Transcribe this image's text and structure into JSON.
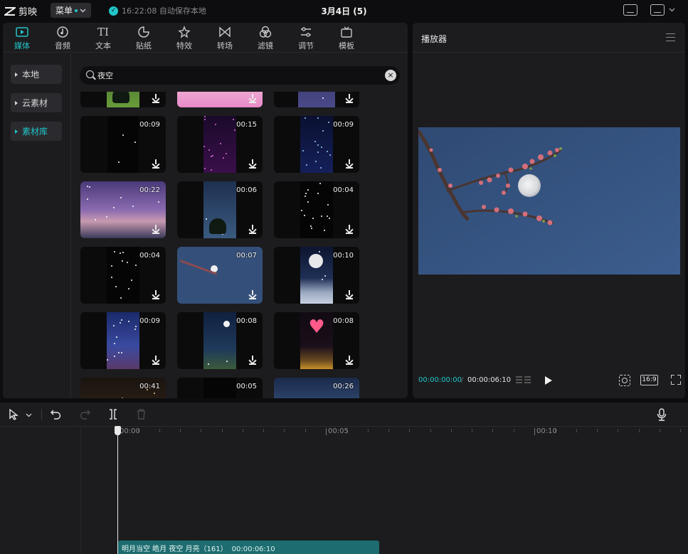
{
  "app": {
    "name": "剪映",
    "menu_label": "菜单",
    "save_status": "16:22:08 自动保存本地",
    "project_title": "3月4日 (5)"
  },
  "tabs": [
    {
      "label": "媒体",
      "icon": "media-icon",
      "active": true
    },
    {
      "label": "音频",
      "icon": "audio-icon"
    },
    {
      "label": "文本",
      "icon": "text-icon",
      "glyph": "TI"
    },
    {
      "label": "贴纸",
      "icon": "sticker-icon"
    },
    {
      "label": "特效",
      "icon": "effects-icon"
    },
    {
      "label": "转场",
      "icon": "transition-icon"
    },
    {
      "label": "滤镜",
      "icon": "filter-icon"
    },
    {
      "label": "调节",
      "icon": "adjust-icon"
    },
    {
      "label": "模板",
      "icon": "template-icon"
    }
  ],
  "side_nav": [
    {
      "label": "本地"
    },
    {
      "label": "云素材"
    },
    {
      "label": "素材库",
      "active": true
    }
  ],
  "search": {
    "value": "夜空"
  },
  "media_tiles": [
    {
      "duration": ""
    },
    {
      "duration": ""
    },
    {
      "duration": ""
    },
    {
      "duration": "00:09"
    },
    {
      "duration": "00:15"
    },
    {
      "duration": "00:09"
    },
    {
      "duration": "00:22"
    },
    {
      "duration": "00:06"
    },
    {
      "duration": "00:04"
    },
    {
      "duration": "00:04"
    },
    {
      "duration": "00:07"
    },
    {
      "duration": "00:10"
    },
    {
      "duration": "00:09"
    },
    {
      "duration": "00:08"
    },
    {
      "duration": "00:08"
    },
    {
      "duration": "00:41"
    },
    {
      "duration": "00:05"
    },
    {
      "duration": "00:26"
    }
  ],
  "player": {
    "title": "播放器",
    "current_time": "00:00:00:00",
    "total_time": "00:00:06:10",
    "ratio": "16:9"
  },
  "timeline": {
    "ruler_labels": [
      "00:00",
      "00:05",
      "00:10"
    ],
    "clip": {
      "title": "明月当空 皓月 夜空 月亮（161）",
      "duration": "00:00:06:10"
    }
  },
  "colors": {
    "accent": "#21c6c9",
    "clip": "#1d6c6f",
    "panel": "#1c1c1e"
  }
}
